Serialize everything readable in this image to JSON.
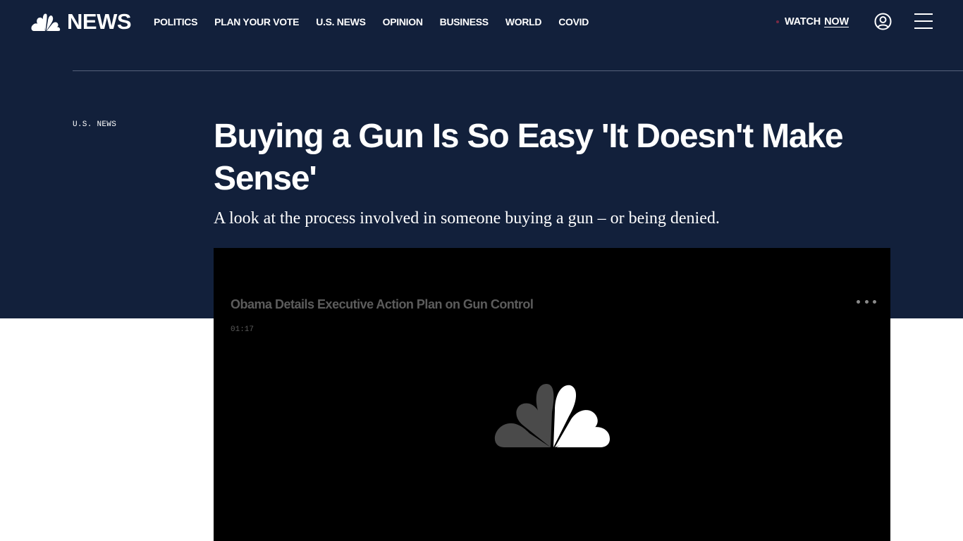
{
  "header": {
    "logo_text": "NEWS",
    "nav": [
      "POLITICS",
      "PLAN YOUR VOTE",
      "U.S. NEWS",
      "OPINION",
      "BUSINESS",
      "WORLD",
      "COVID"
    ],
    "watch_label": "WATCH",
    "watch_now": "NOW"
  },
  "article": {
    "section": "U.S. NEWS",
    "headline": "Buying a Gun Is So Easy 'It Doesn't Make Sense'",
    "dek": "A look at the process involved in someone buying a gun – or being denied."
  },
  "video": {
    "title": "Obama Details Executive Action Plan on Gun Control",
    "duration": "01:17"
  },
  "colors": {
    "hero_background": "#12203b",
    "video_background": "#000000"
  },
  "icons": {
    "logo": "nbc-peacock-icon",
    "account": "user-circle-icon",
    "menu": "hamburger-menu-icon",
    "more": "more-dots-icon"
  }
}
